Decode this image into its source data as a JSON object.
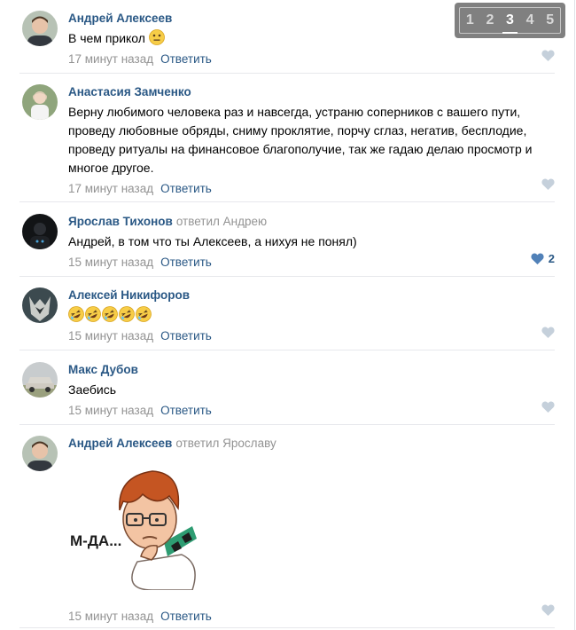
{
  "pager": {
    "pages": [
      "1",
      "2",
      "3",
      "4",
      "5"
    ],
    "active_index": 2
  },
  "comments": [
    {
      "author": "Андрей Алексеев",
      "reply_to": "",
      "text": "В чем прикол",
      "time": "17 минут назад",
      "reply_label": "Ответить",
      "likes": "",
      "liked": false
    },
    {
      "author": "Анастасия Замченко",
      "reply_to": "",
      "text": "Верну любимого человека раз и навсегда, устраню соперников с вашего пути, проведу любовные обряды, сниму проклятие, порчу сглаз, негатив, бесплодие, проведу ритуалы на финансовое благополучие, так же гадаю делаю просмотр и многое другое.",
      "time": "17 минут назад",
      "reply_label": "Ответить",
      "likes": "",
      "liked": false
    },
    {
      "author": "Ярослав Тихонов",
      "reply_to": "ответил Андрею",
      "text": "Андрей, в том что ты Алексеев, а нихуя не понял)",
      "time": "15 минут назад",
      "reply_label": "Ответить",
      "likes": "2",
      "liked": true
    },
    {
      "author": "Алексей Никифоров",
      "reply_to": "",
      "text": "",
      "emoji_count": 5,
      "time": "15 минут назад",
      "reply_label": "Ответить",
      "likes": "",
      "liked": false
    },
    {
      "author": "Макс Дубов",
      "reply_to": "",
      "text": "Заебись",
      "time": "15 минут назад",
      "reply_label": "Ответить",
      "likes": "",
      "liked": false
    },
    {
      "author": "Андрей Алексеев",
      "reply_to": "ответил Ярославу",
      "text": "",
      "sticker_text": "М-ДА...",
      "time": "15 минут назад",
      "reply_label": "Ответить",
      "likes": "",
      "liked": false
    }
  ],
  "colors": {
    "link": "#2a5885",
    "muted": "#939393",
    "like_idle": "#c5d0db",
    "like_active": "#5181b8"
  }
}
